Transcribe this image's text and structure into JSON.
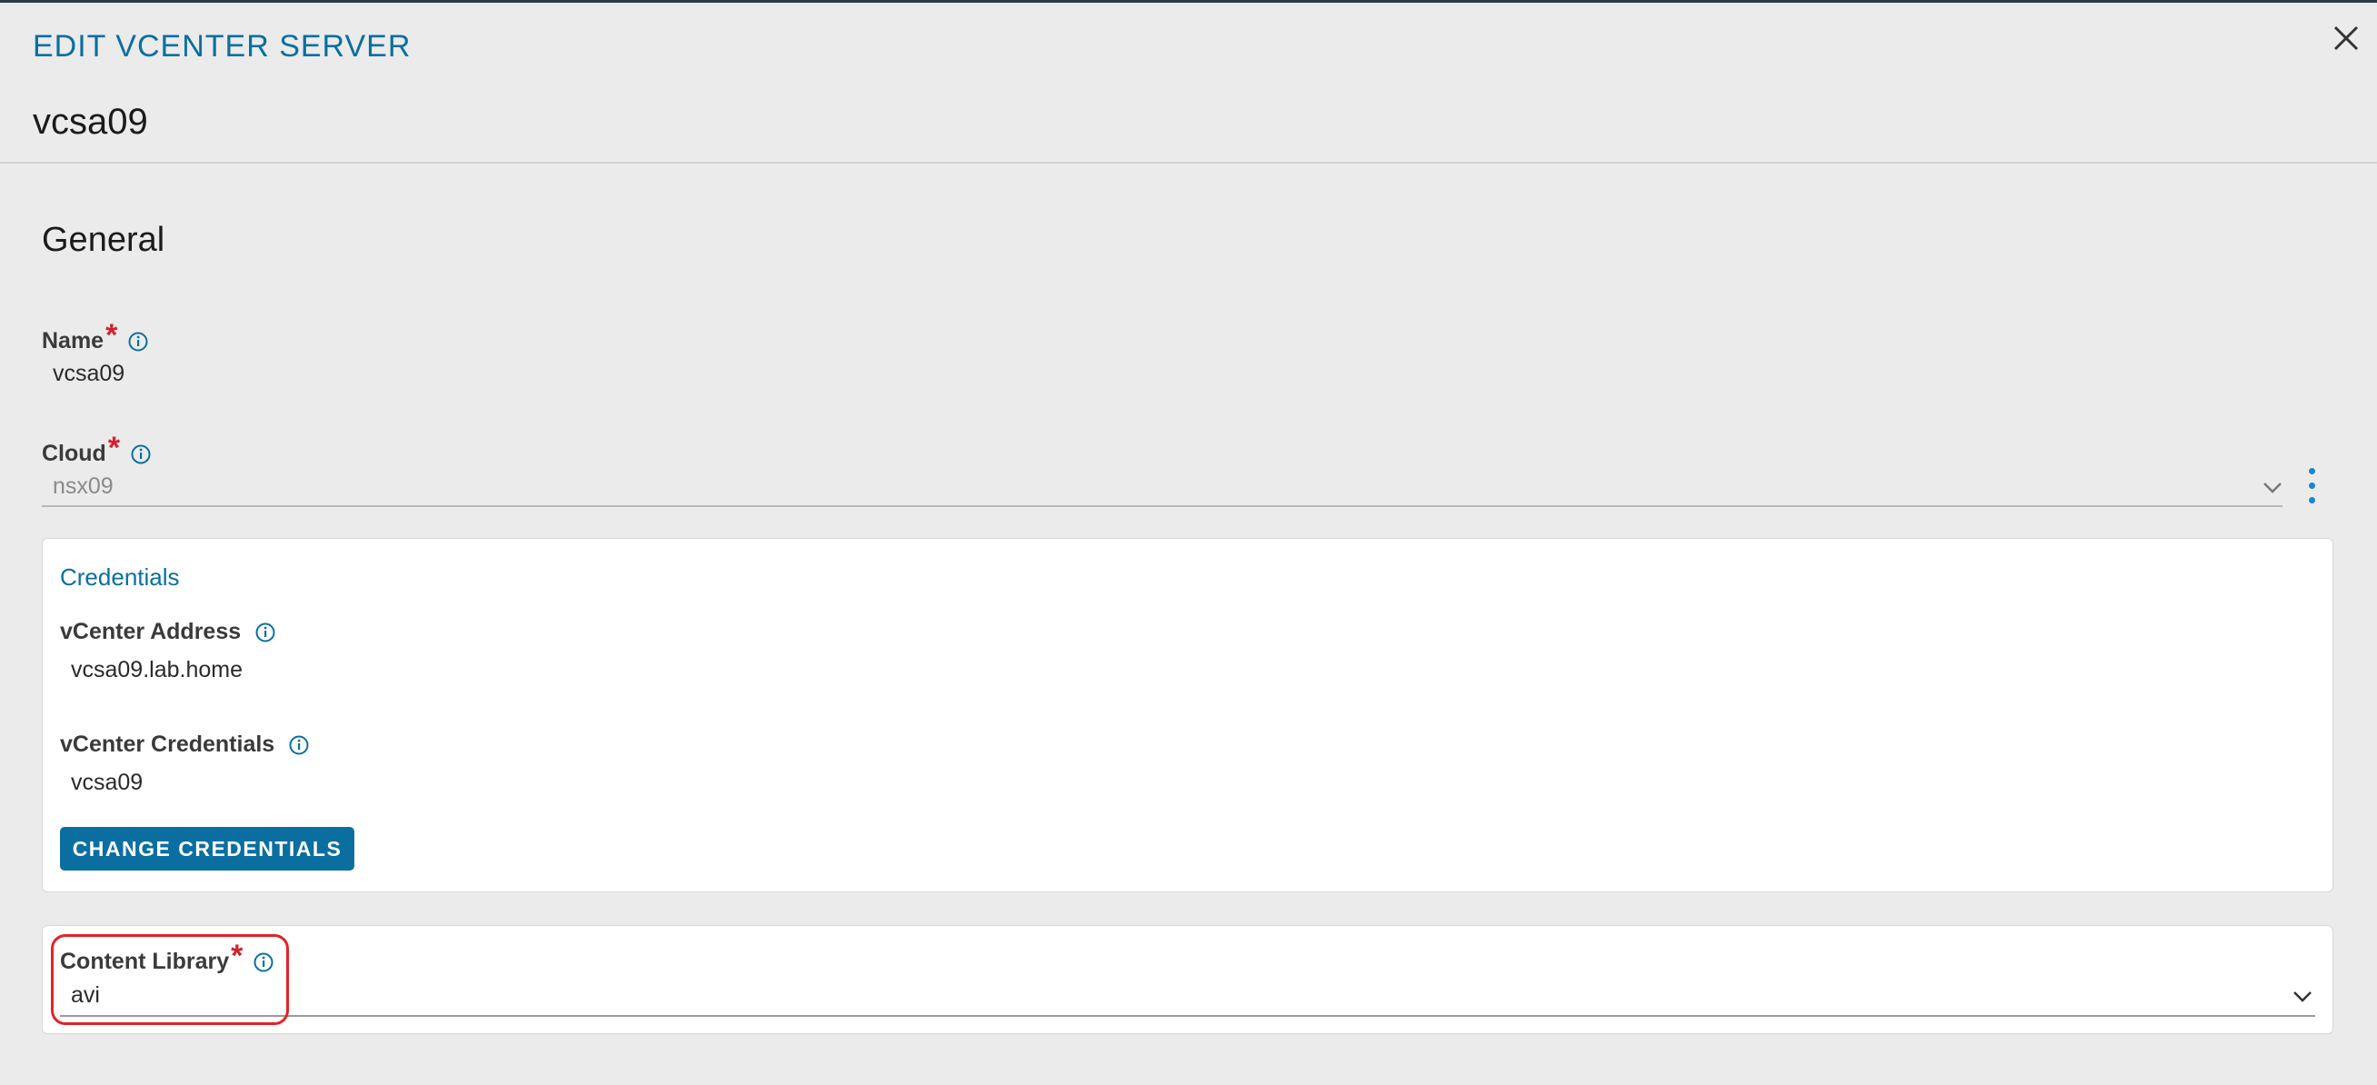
{
  "modal": {
    "title": "EDIT VCENTER SERVER",
    "subtitle": "vcsa09"
  },
  "general": {
    "heading": "General",
    "name": {
      "label": "Name",
      "value": "vcsa09"
    },
    "cloud": {
      "label": "Cloud",
      "value": "nsx09"
    }
  },
  "credentials": {
    "heading": "Credentials",
    "address": {
      "label": "vCenter Address",
      "value": "vcsa09.lab.home"
    },
    "creds": {
      "label": "vCenter Credentials",
      "value": "vcsa09"
    },
    "change_button": "CHANGE CREDENTIALS"
  },
  "content_library": {
    "label": "Content Library",
    "value": "avi"
  },
  "colors": {
    "accent": "#0a6fa0",
    "required": "#d3212d",
    "highlight": "#e3222a"
  }
}
